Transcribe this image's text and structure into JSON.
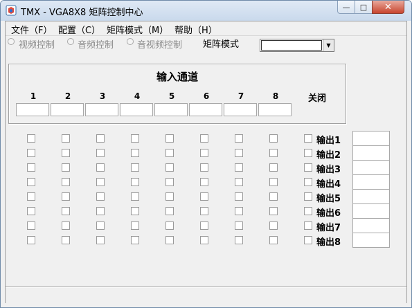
{
  "window": {
    "title": "TMX - VGA8X8 矩阵控制中心",
    "min_glyph": "—",
    "max_glyph": "□",
    "close_glyph": "✕"
  },
  "menu": [
    "文件（F）",
    "配置（C）",
    "矩阵模式（M）",
    "帮助（H）"
  ],
  "control_mode": {
    "options": [
      "视频控制",
      "音频控制",
      "音视频控制"
    ],
    "label": "矩阵模式",
    "select_value": ""
  },
  "input_group": {
    "title": "输入通道",
    "channels": [
      "1",
      "2",
      "3",
      "4",
      "5",
      "6",
      "7",
      "8"
    ],
    "close_label": "关闭"
  },
  "outputs": [
    "输出1",
    "输出2",
    "输出3",
    "输出4",
    "输出5",
    "输出6",
    "输出7",
    "输出8"
  ],
  "status_text": ""
}
